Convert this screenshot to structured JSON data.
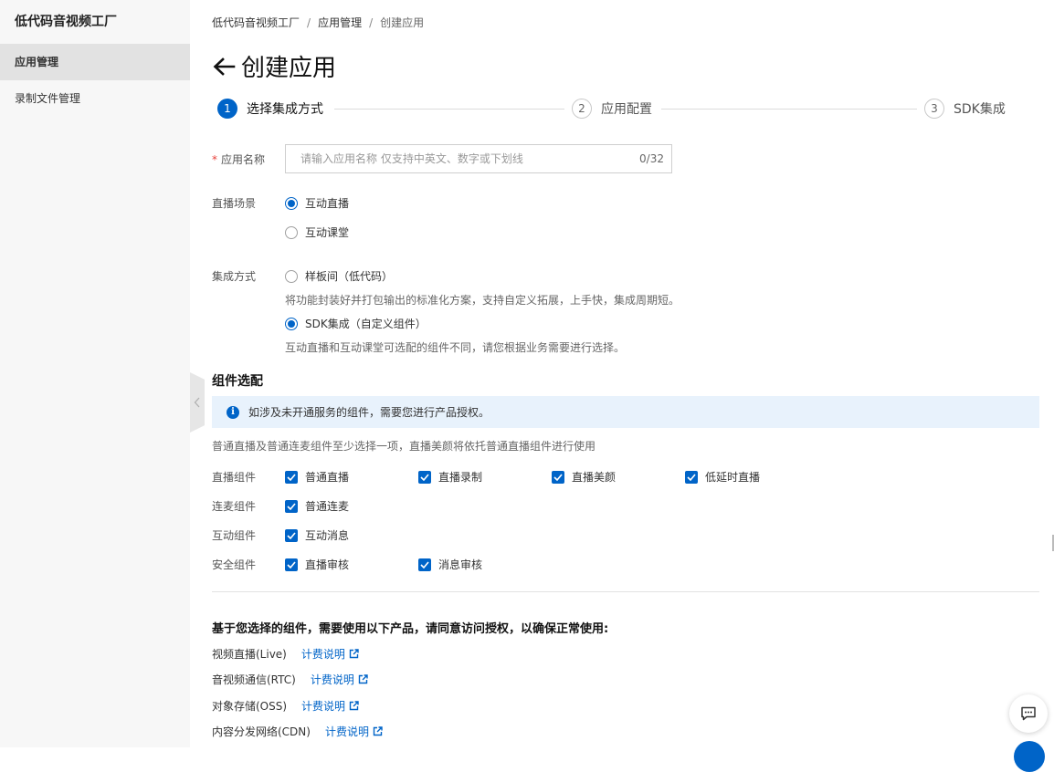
{
  "sidebar": {
    "brand": "低代码音视频工厂",
    "items": [
      {
        "label": "应用管理",
        "active": true
      },
      {
        "label": "录制文件管理",
        "active": false
      }
    ]
  },
  "breadcrumb": [
    "低代码音视频工厂",
    "应用管理",
    "创建应用"
  ],
  "breadcrumb_separator": "/",
  "page": {
    "title": "创建应用",
    "back_icon": "arrow-left-icon"
  },
  "steps": [
    {
      "num": "1",
      "label": "选择集成方式",
      "active": true
    },
    {
      "num": "2",
      "label": "应用配置",
      "active": false
    },
    {
      "num": "3",
      "label": "SDK集成",
      "active": false
    }
  ],
  "form": {
    "app_name": {
      "required_mark": "*",
      "label": "应用名称",
      "placeholder": "请输入应用名称 仅支持中英文、数字或下划线",
      "value": "",
      "counter": "0/32"
    },
    "scene": {
      "label": "直播场景",
      "options": [
        {
          "label": "互动直播",
          "checked": true
        },
        {
          "label": "互动课堂",
          "checked": false
        }
      ]
    },
    "integration": {
      "label": "集成方式",
      "options": [
        {
          "label": "样板间（低代码）",
          "checked": false,
          "help": "将功能封装好并打包输出的标准化方案，支持自定义拓展，上手快，集成周期短。"
        },
        {
          "label": "SDK集成（自定义组件）",
          "checked": true,
          "help": "互动直播和互动课堂可选配的组件不同，请您根据业务需要进行选择。"
        }
      ]
    }
  },
  "components": {
    "title": "组件选配",
    "notice": "如涉及未开通服务的组件，需要您进行产品授权。",
    "hint": "普通直播及普通连麦组件至少选择一项，直播美颜将依托普通直播组件进行使用",
    "groups": [
      {
        "label": "直播组件",
        "items": [
          {
            "label": "普通直播",
            "checked": true
          },
          {
            "label": "直播录制",
            "checked": true
          },
          {
            "label": "直播美颜",
            "checked": true
          },
          {
            "label": "低延时直播",
            "checked": true
          }
        ]
      },
      {
        "label": "连麦组件",
        "items": [
          {
            "label": "普通连麦",
            "checked": true
          }
        ]
      },
      {
        "label": "互动组件",
        "items": [
          {
            "label": "互动消息",
            "checked": true
          }
        ]
      },
      {
        "label": "安全组件",
        "items": [
          {
            "label": "直播审核",
            "checked": true
          },
          {
            "label": "消息审核",
            "checked": true
          }
        ]
      }
    ]
  },
  "consent": {
    "title": "基于您选择的组件，需要使用以下产品，请同意访问授权，以确保正常使用:",
    "products": [
      {
        "name": "视频直播(Live)",
        "link": "计费说明"
      },
      {
        "name": "音视频通信(RTC)",
        "link": "计费说明"
      },
      {
        "name": "对象存储(OSS)",
        "link": "计费说明"
      },
      {
        "name": "内容分发网络(CDN)",
        "link": "计费说明"
      }
    ]
  },
  "colors": {
    "accent": "#0064c8",
    "required": "#e8403a",
    "notice_bg": "#e8f2fc",
    "sidebar_bg": "#f7f7f7"
  }
}
